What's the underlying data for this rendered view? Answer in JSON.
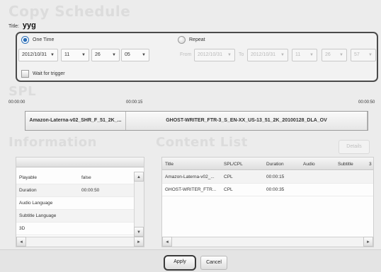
{
  "header": {
    "section_title": "Copy Schedule",
    "title_label": "Title:",
    "title_value": "yyg"
  },
  "schedule": {
    "one_time_label": "One Time",
    "one_time_checked": true,
    "repeat_label": "Repeat",
    "repeat_checked": false,
    "date": "2012/10/31",
    "hour": "11",
    "minute": "26",
    "second": "05",
    "from_label": "From",
    "from_date": "2012/10/31",
    "to_label": "To",
    "to_date": "2012/10/31",
    "repeat_hour": "11",
    "repeat_minute": "26",
    "repeat_second": "57",
    "wait_for_trigger_label": "Wait for trigger"
  },
  "spl": {
    "section_title": "SPL",
    "time_start": "00:00:00",
    "time_mid": "00:00:15",
    "time_end": "00:00:50",
    "clips": [
      {
        "title": "Amazon-Laterna-v02_SHR_F_51_2K_..."
      },
      {
        "title": "GHOST-WRITER_FTR-3_S_EN-XX_US-13_51_2K_20100128_DLA_OV"
      }
    ]
  },
  "information": {
    "section_title": "Information",
    "rows": [
      {
        "key": "Playable",
        "value": "false"
      },
      {
        "key": "Duration",
        "value": "00:00:50"
      },
      {
        "key": "Audio Language",
        "value": ""
      },
      {
        "key": "Subtitle Language",
        "value": ""
      },
      {
        "key": "3D",
        "value": ""
      }
    ]
  },
  "content_list": {
    "section_title": "Content List",
    "details_label": "Details",
    "columns": [
      "Title",
      "SPL/CPL",
      "Duration",
      "Audio",
      "Subtitle",
      "3"
    ],
    "rows": [
      {
        "title": "Amazon-Laterna-v02_...",
        "type": "CPL",
        "duration": "00:00:15"
      },
      {
        "title": "GHOST-WRITER_FTR...",
        "type": "CPL",
        "duration": "00:00:35"
      }
    ]
  },
  "footer": {
    "apply_label": "Apply",
    "cancel_label": "Cancel"
  },
  "icons": {
    "dropdown_arrow": "▼",
    "scroll_up": "▲",
    "scroll_down": "▼",
    "scroll_left": "◄",
    "scroll_right": "►"
  }
}
